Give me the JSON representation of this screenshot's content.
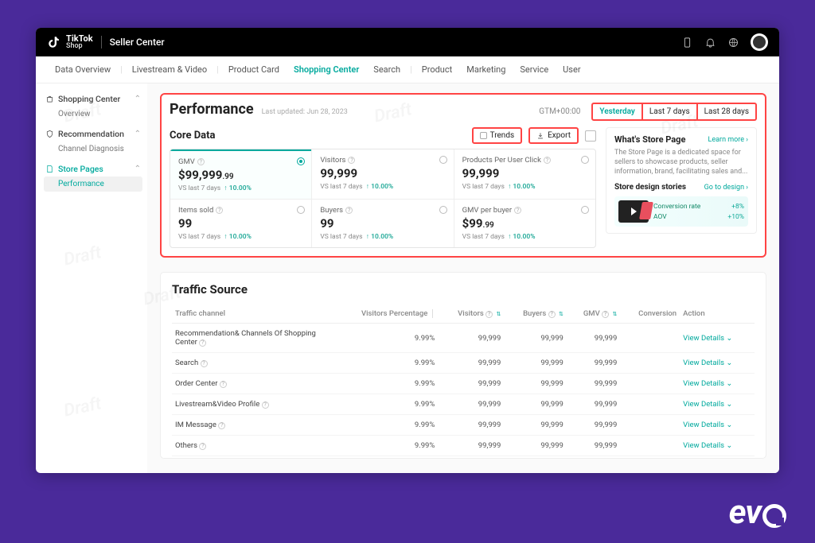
{
  "header": {
    "brand_top": "TikTok",
    "brand_bottom": "Shop",
    "title": "Seller Center"
  },
  "tabs": [
    "Data Overview",
    "Livestream & Video",
    "Product Card",
    "Shopping Center",
    "Search",
    "Product",
    "Marketing",
    "Service",
    "User"
  ],
  "active_tab": "Shopping Center",
  "sidebar": [
    {
      "icon": "bag",
      "label": "Shopping Center",
      "children": [
        "Overview"
      ],
      "active": false
    },
    {
      "icon": "shield",
      "label": "Recommendation",
      "children": [
        "Channel Diagnosis"
      ],
      "active": false
    },
    {
      "icon": "page",
      "label": "Store Pages",
      "children": [
        "Performance"
      ],
      "active": true,
      "active_child": "Performance"
    }
  ],
  "performance": {
    "title": "Performance",
    "updated": "Last updated: Jun 28, 2023",
    "tz": "GTM+00:00",
    "ranges": [
      "Yesterday",
      "Last 7 days",
      "Last 28 days"
    ],
    "active_range": "Yesterday"
  },
  "core": {
    "title": "Core Data",
    "trends_label": "Trends",
    "export_label": "Export",
    "metrics_row1": [
      {
        "label": "GMV",
        "val": "$99,999",
        "cents": ".99",
        "comp": "VS last 7 days",
        "delta": "10.00%",
        "selected": true
      },
      {
        "label": "Visitors",
        "val": "99,999",
        "comp": "VS last 7 days",
        "delta": "10.00%"
      },
      {
        "label": "Products Per User Click",
        "val": "99,999",
        "comp": "VS last 7 days",
        "delta": "10.00%"
      }
    ],
    "metrics_row2": [
      {
        "label": "Items sold",
        "val": "99",
        "comp": "VS last 7 days",
        "delta": "10.00%"
      },
      {
        "label": "Buyers",
        "val": "99",
        "comp": "VS last 7 days",
        "delta": "10.00%"
      },
      {
        "label": "GMV per buyer",
        "val": "$99",
        "cents": ".99",
        "comp": "VS last 7 days",
        "delta": "10.00%"
      }
    ]
  },
  "right_card": {
    "title": "What's Store Page",
    "link": "Learn more",
    "desc": "The Store Page is a dedicated space for sellers to showcase products, seller information, brand, facilitating sales and...",
    "sub_title": "Store design stories",
    "sub_link": "Go to design",
    "stats": [
      {
        "label": "Conversion rate",
        "val": "+8%"
      },
      {
        "label": "AOV",
        "val": "+10%"
      }
    ]
  },
  "traffic": {
    "title": "Traffic Source",
    "headers": [
      "Traffic channel",
      "Visitors Percentage",
      "Visitors",
      "Buyers",
      "GMV",
      "Conversion",
      "Action"
    ],
    "action_label": "View Details",
    "rows": [
      {
        "ch": "Recommendation& Channels Of Shopping Center",
        "vp": "9.99%",
        "v": "99,999",
        "b": "99,999",
        "g": "99,999"
      },
      {
        "ch": "Search",
        "vp": "9.99%",
        "v": "99,999",
        "b": "99,999",
        "g": "99,999"
      },
      {
        "ch": "Order Center",
        "vp": "9.99%",
        "v": "99,999",
        "b": "99,999",
        "g": "99,999"
      },
      {
        "ch": "Livestream&Video Profile",
        "vp": "9.99%",
        "v": "99,999",
        "b": "99,999",
        "g": "99,999"
      },
      {
        "ch": "IM Message",
        "vp": "9.99%",
        "v": "99,999",
        "b": "99,999",
        "g": "99,999"
      },
      {
        "ch": "Others",
        "vp": "9.99%",
        "v": "99,999",
        "b": "99,999",
        "g": "99,999"
      }
    ]
  }
}
